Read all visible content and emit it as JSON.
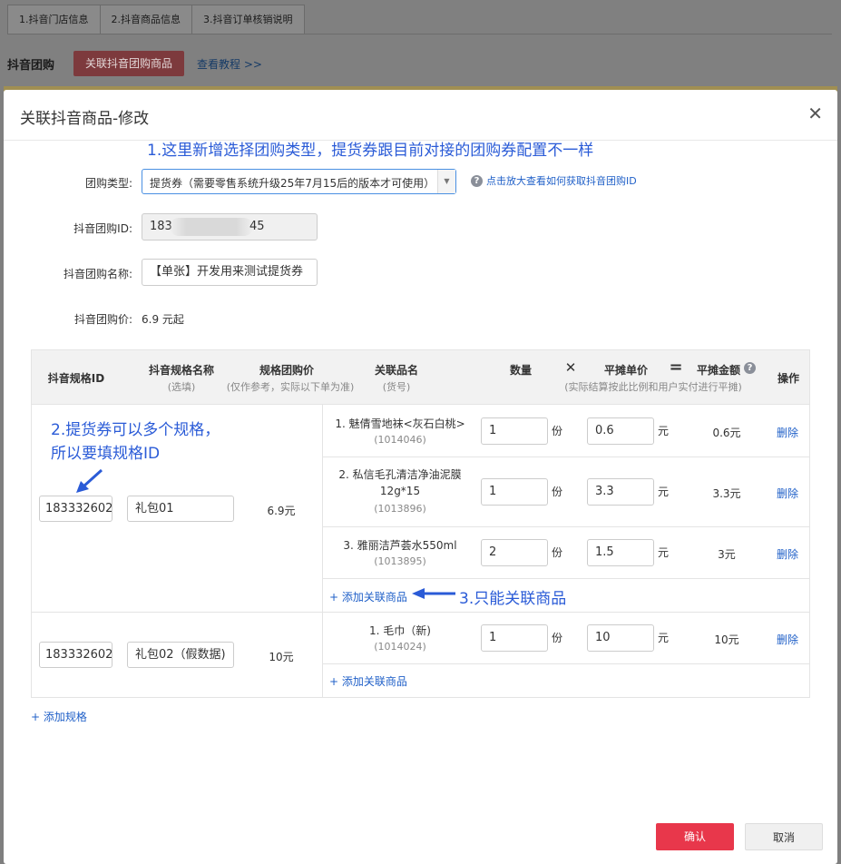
{
  "bg": {
    "tabs": [
      "1.抖音门店信息",
      "2.抖音商品信息",
      "3.抖音订单核销说明"
    ],
    "section_title": "抖音团购",
    "link_button": "关联抖音团购商品",
    "tutorial_link": "查看教程 >>"
  },
  "modal": {
    "title": "关联抖音商品-修改",
    "close_glyph": "✕"
  },
  "annotations": {
    "a1": "1.这里新增选择团购类型，提货券跟目前对接的团购券配置不一样",
    "a2_line1": "2.提货券可以多个规格，",
    "a2_line2": "所以要填规格ID",
    "a3": "3.只能关联商品"
  },
  "form": {
    "type_label": "团购类型:",
    "type_value": "提货券（需要零售系统升级25年7月15后的版本才可使用）",
    "help_text": "点击放大查看如何获取抖音团购ID",
    "id_label": "抖音团购ID:",
    "id_prefix": "183",
    "id_suffix": "45",
    "name_label": "抖音团购名称:",
    "name_value": "【单张】开发用来测试提货券",
    "price_label": "抖音团购价:",
    "price_value": "6.9 元起"
  },
  "table": {
    "headers": {
      "spec_id": "抖音规格ID",
      "spec_name": "抖音规格名称",
      "spec_name_sub": "(选填)",
      "spec_price": "规格团购价",
      "spec_price_sub": "(仅作参考，实际以下单为准)",
      "product": "关联品名",
      "product_sub": "(货号)",
      "qty": "数量",
      "times": "✕",
      "unit_price": "平摊单价",
      "equals": "=",
      "amount": "平摊金额",
      "amount_help": "?",
      "alloc_sub": "(实际结算按此比例和用户实付进行平摊)",
      "action": "操作"
    },
    "specs": [
      {
        "id": "183332602",
        "name": "礼包01",
        "price": "6.9元",
        "items": [
          {
            "name": "1. 魅倩雪地袜<灰石白桃>",
            "name2": "",
            "code": "(1014046)",
            "qty": "1",
            "qty_unit": "份",
            "unit_price": "0.6",
            "price_unit": "元",
            "amount": "0.6元",
            "del": "删除"
          },
          {
            "name": "2. 私信毛孔清洁净油泥膜",
            "name2": "12g*15",
            "code": "(1013896)",
            "qty": "1",
            "qty_unit": "份",
            "unit_price": "3.3",
            "price_unit": "元",
            "amount": "3.3元",
            "del": "删除"
          },
          {
            "name": "3. 雅丽洁芦荟水550ml",
            "name2": "",
            "code": "(1013895)",
            "qty": "2",
            "qty_unit": "份",
            "unit_price": "1.5",
            "price_unit": "元",
            "amount": "3元",
            "del": "删除"
          }
        ],
        "add_product": "+ 添加关联商品"
      },
      {
        "id": "183332602",
        "name": "礼包02（假数据)",
        "price": "10元",
        "items": [
          {
            "name": "1. 毛巾（新)",
            "name2": "",
            "code": "(1014024)",
            "qty": "1",
            "qty_unit": "份",
            "unit_price": "10",
            "price_unit": "元",
            "amount": "10元",
            "del": "删除"
          }
        ],
        "add_product": "+ 添加关联商品"
      }
    ],
    "add_spec": "+ 添加规格"
  },
  "footer": {
    "ok": "确认",
    "cancel": "取消"
  },
  "colors": {
    "accent_blue": "#2a5bd7",
    "link_blue": "#2060c8",
    "confirm_red": "#e8374b"
  }
}
